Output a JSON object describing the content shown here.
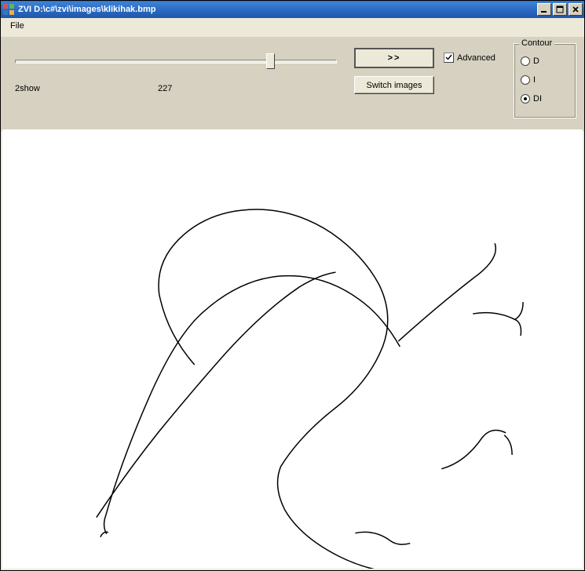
{
  "titlebar": {
    "title": "ZVI D:\\c#\\zvi\\images\\klikihak.bmp"
  },
  "menu": {
    "file": "File"
  },
  "slider": {
    "min": 0,
    "max": 255,
    "value": 200,
    "thumb_left_pct": 78
  },
  "labels": {
    "show": "2show",
    "value": "227"
  },
  "buttons": {
    "arrows": ">>",
    "switch": "Switch images"
  },
  "checkbox": {
    "advanced_label": "Advanced",
    "advanced_checked": true
  },
  "group": {
    "legend": "Contour",
    "options": [
      {
        "label": "D",
        "checked": false
      },
      {
        "label": "I",
        "checked": false
      },
      {
        "label": "DI",
        "checked": true
      }
    ]
  }
}
